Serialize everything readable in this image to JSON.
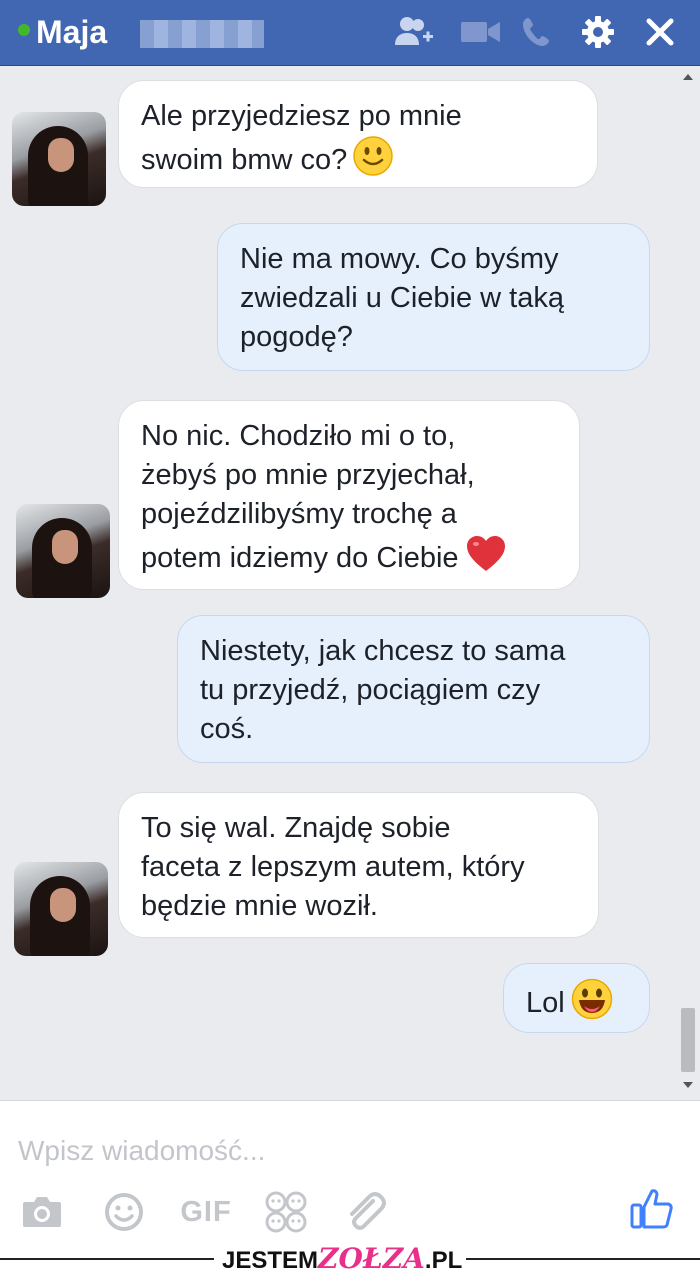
{
  "header": {
    "contact_name": "Maja",
    "online_color": "#42b72a",
    "icons": [
      "add-friend-icon",
      "video-call-icon",
      "phone-icon",
      "gear-icon",
      "close-icon"
    ]
  },
  "messages": [
    {
      "direction": "incoming",
      "lines": [
        "Ale przyjedziesz po mnie",
        "swoim bmw co?"
      ],
      "emoji": "smile-emoji"
    },
    {
      "direction": "outgoing",
      "lines": [
        "Nie ma mowy. Co byśmy",
        "zwiedzali u Ciebie w taką",
        "pogodę?"
      ]
    },
    {
      "direction": "incoming",
      "lines": [
        "No nic. Chodziło mi o to,",
        "żebyś po mnie przyjechał,",
        "pojeździlibyśmy trochę a",
        "potem idziemy do Ciebie"
      ],
      "emoji": "heart-emoji"
    },
    {
      "direction": "outgoing",
      "lines": [
        "Niestety, jak chcesz to sama",
        "tu przyjedź, pociągiem czy",
        "coś."
      ]
    },
    {
      "direction": "incoming",
      "lines": [
        "To się wal. Znajdę sobie",
        "faceta z lepszym autem, który",
        "będzie mnie woził."
      ]
    },
    {
      "direction": "outgoing",
      "lines": [
        "Lol"
      ],
      "emoji": "grin-emoji"
    }
  ],
  "composer": {
    "placeholder": "Wpisz wiadomość...",
    "gif_label": "GIF",
    "icons": [
      "camera-icon",
      "emoji-icon",
      "gif-icon",
      "sticker-icon",
      "attachment-icon",
      "like-icon"
    ]
  },
  "watermark": {
    "prefix": "JESTEM",
    "accent": "ZOŁZA",
    "suffix": ".PL"
  },
  "colors": {
    "header": "#4267b2",
    "chat_background": "#e9ebee",
    "incoming_bubble": "#ffffff",
    "outgoing_bubble": "#e5f0fc",
    "like": "#4080ff"
  }
}
